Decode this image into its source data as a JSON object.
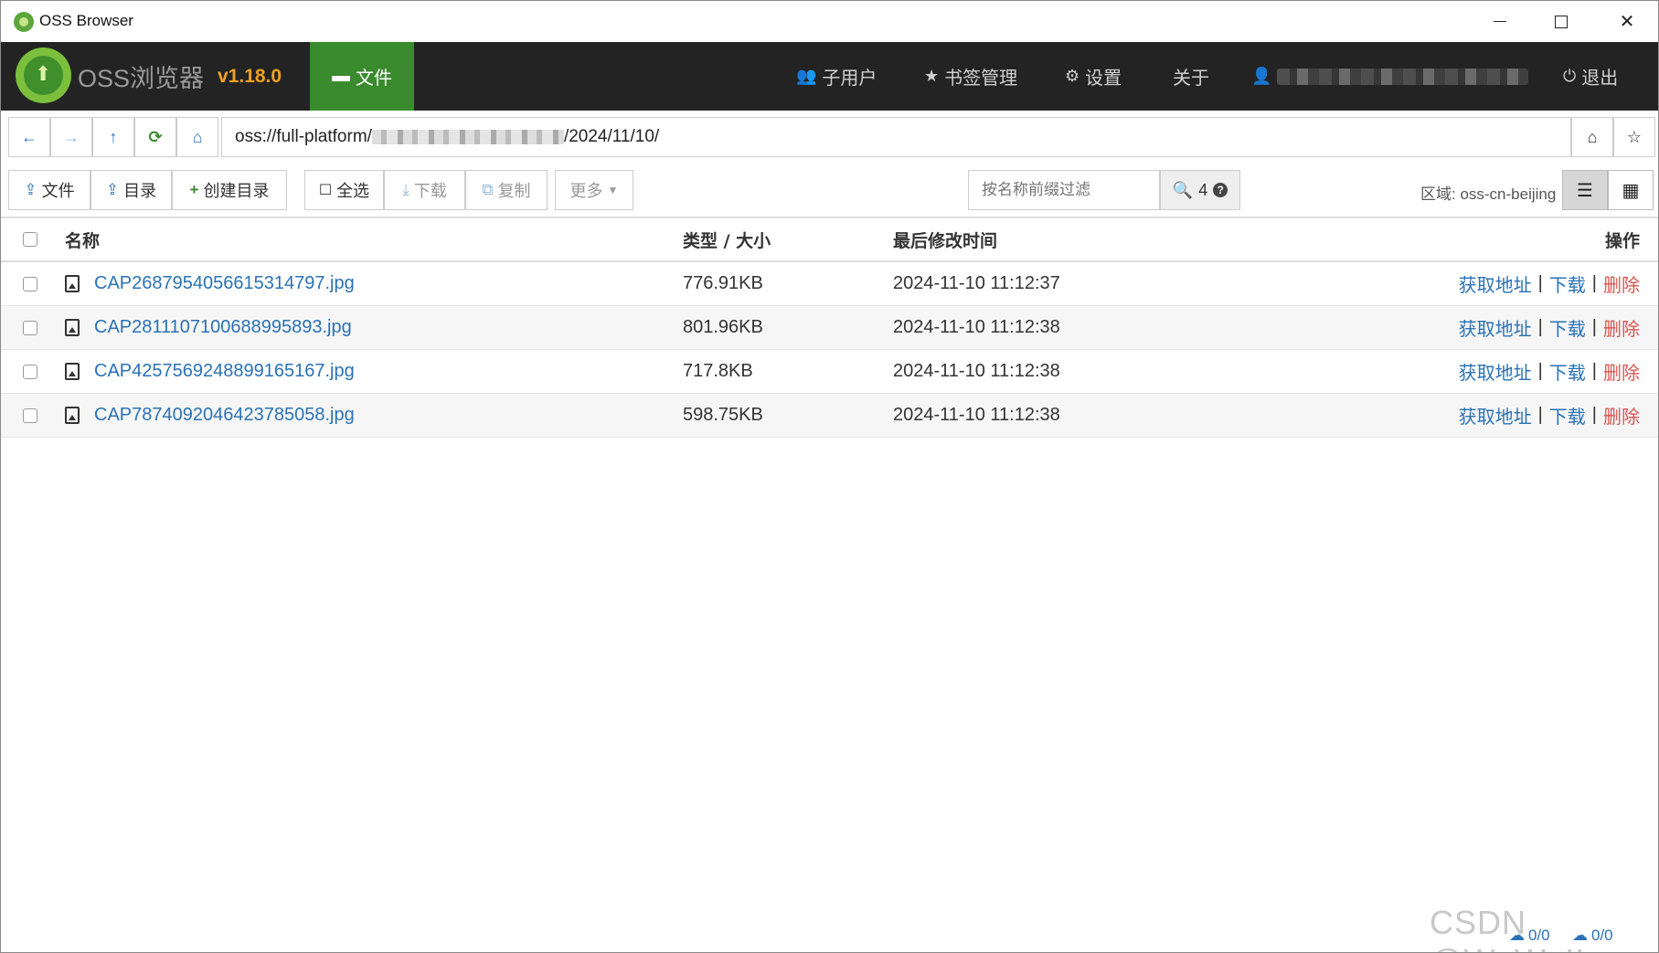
{
  "window": {
    "title": "OSS Browser"
  },
  "header": {
    "brand": "OSS浏览器",
    "version": "v1.18.0",
    "nav_files": "文件",
    "nav_subusers": "子用户",
    "nav_bookmarks": "书签管理",
    "nav_settings": "设置",
    "nav_about": "关于",
    "nav_logout": "退出"
  },
  "address": {
    "prefix": "oss://full-platform/",
    "suffix": "/2024/11/10/"
  },
  "toolbar": {
    "upload_file": "文件",
    "upload_dir": "目录",
    "create_dir": "创建目录",
    "select_all": "全选",
    "download": "下载",
    "copy": "复制",
    "more": "更多",
    "filter_placeholder": "按名称前缀过滤",
    "search_count": "4",
    "region": "区域: oss-cn-beijing"
  },
  "table": {
    "columns": {
      "name": "名称",
      "type_size": "类型 / 大小",
      "modified": "最后修改时间",
      "actions": "操作"
    },
    "rows": [
      {
        "name": "CAP2687954056615314797.jpg",
        "size": "776.91KB",
        "modified": "2024-11-10 11:12:37"
      },
      {
        "name": "CAP2811107100688995893.jpg",
        "size": "801.96KB",
        "modified": "2024-11-10 11:12:38"
      },
      {
        "name": "CAP4257569248899165167.jpg",
        "size": "717.8KB",
        "modified": "2024-11-10 11:12:38"
      },
      {
        "name": "CAP7874092046423785058.jpg",
        "size": "598.75KB",
        "modified": "2024-11-10 11:12:38"
      }
    ],
    "action_get_url": "获取地址",
    "action_download": "下载",
    "action_delete": "删除",
    "action_separator": "|"
  },
  "status": {
    "upload": "0/0",
    "download": "0/0"
  },
  "watermark": "CSDN @WuWuII"
}
